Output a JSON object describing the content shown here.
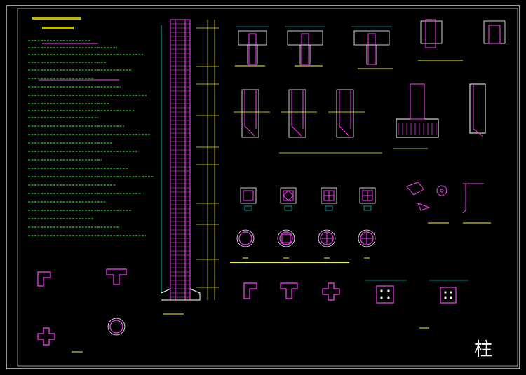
{
  "drawing": {
    "big_label": "柱",
    "colors": {
      "background": "#000000",
      "frame": "#ffffff",
      "column_outline": "#ff40ff",
      "rebar": "#ff40ff",
      "text": "#ffff00",
      "dimension": "#00ffff",
      "notes": "#40ff40",
      "concrete": "#ffffff"
    },
    "icons": [
      "column-rebar-elevation-icon",
      "beam-column-joint-icon",
      "rebar-cage-section-icon",
      "circular-column-section-icon",
      "l-column-section-icon",
      "t-column-section-icon",
      "cross-column-section-icon"
    ]
  }
}
